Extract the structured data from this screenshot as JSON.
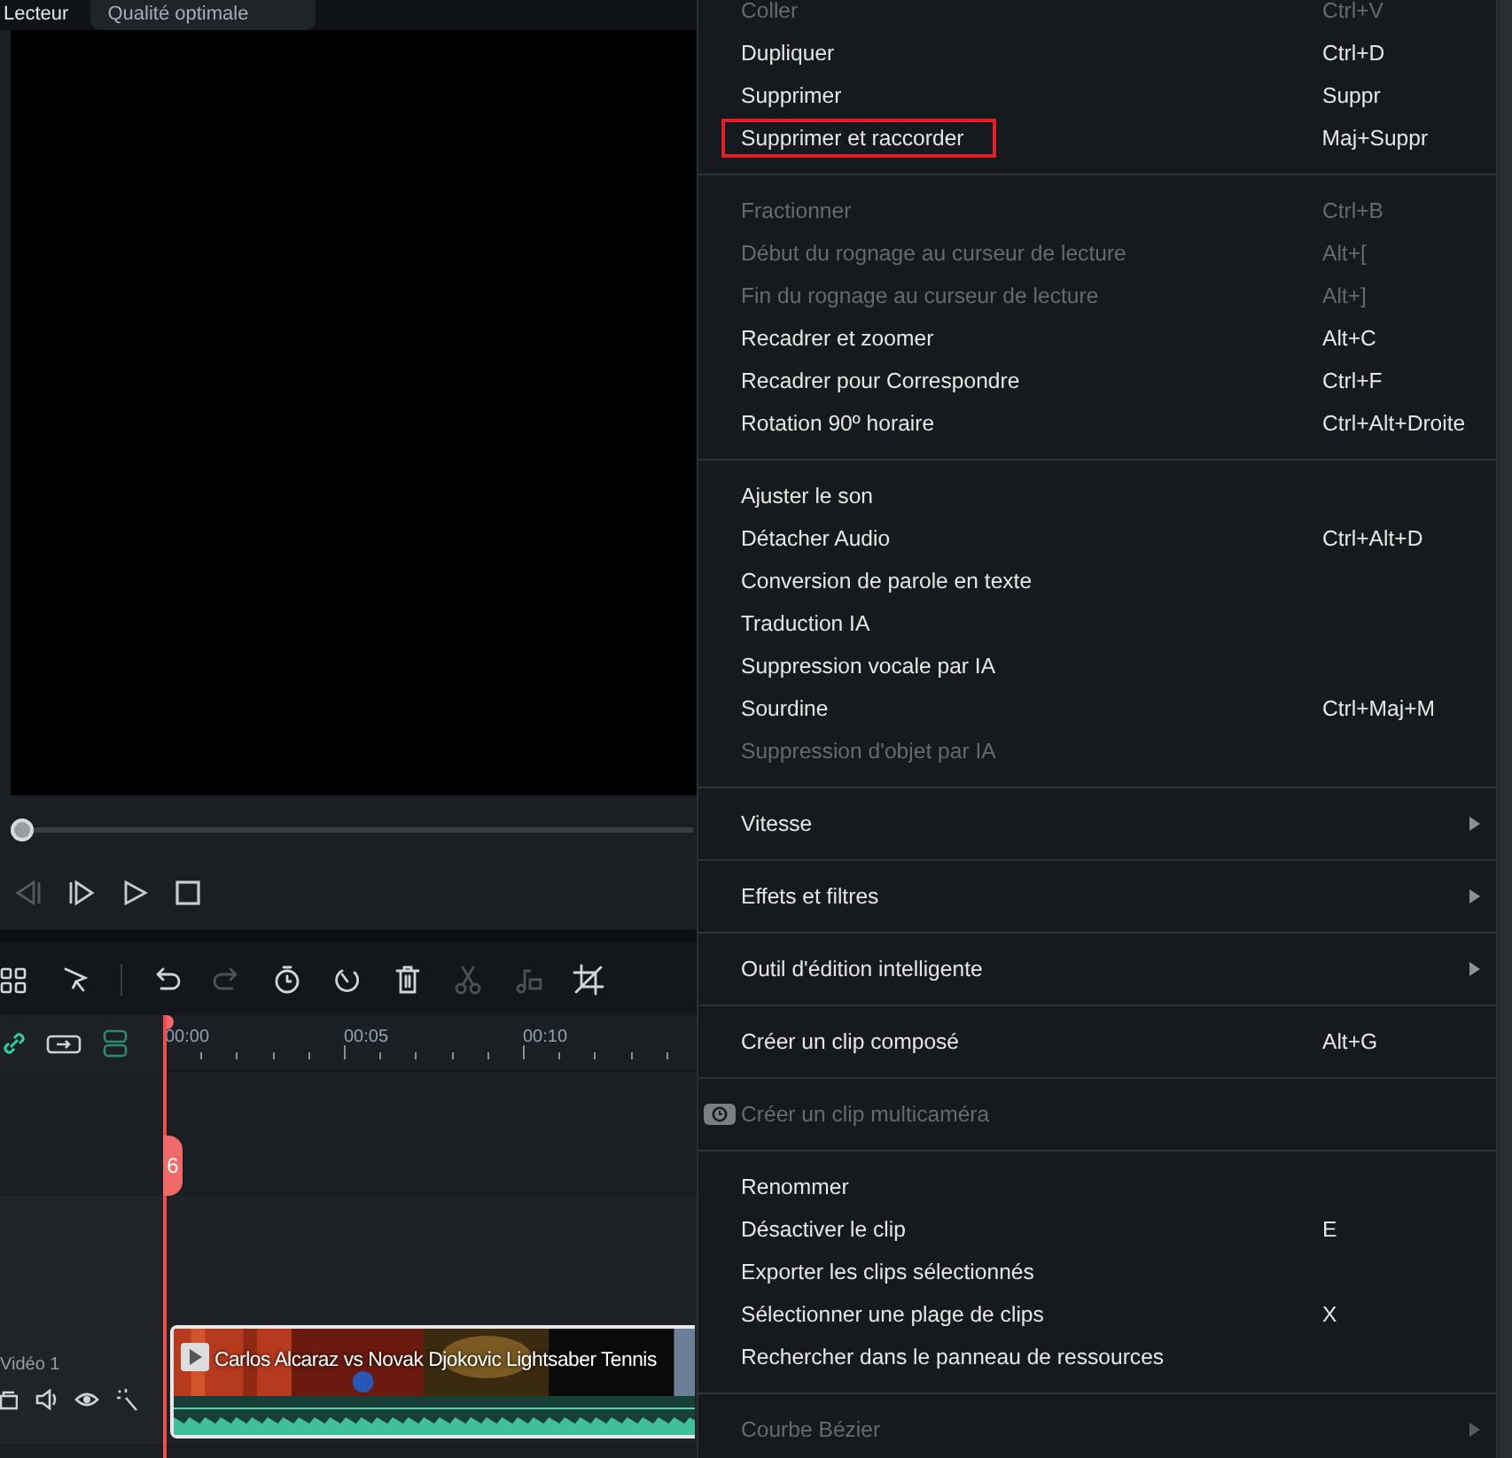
{
  "player": {
    "title": "Lecteur",
    "quality": "Qualité optimale",
    "scrubber": {
      "level": 0
    },
    "controls": [
      {
        "disabled": true
      },
      {
        "disabled": false
      },
      {
        "disabled": false
      },
      {
        "disabled": false
      }
    ]
  },
  "toolbar": [
    {
      "disabled": false
    },
    {
      "disabled": false
    },
    {
      "disabled": false
    },
    {
      "disabled": true
    },
    {
      "disabled": false
    },
    {
      "disabled": false
    },
    {
      "disabled": false
    },
    {
      "disabled": true
    },
    {
      "disabled": true
    },
    {
      "disabled": false
    }
  ],
  "timeline": {
    "ruler": [
      "00:00",
      "00:05",
      "00:10"
    ],
    "playhead_tag": "6",
    "tracks": [
      {
        "kind": "empty"
      },
      {
        "kind": "empty"
      },
      {
        "kind": "video",
        "name": "Vidéo 1",
        "clip": {
          "title": "Carlos Alcaraz vs Novak Djokovic Lightsaber Tennis",
          "selected": true
        }
      }
    ]
  },
  "context_menu": {
    "groups": [
      {
        "items": [
          {
            "label": "Coller",
            "shortcut": "Ctrl+V",
            "disabled": true
          },
          {
            "label": "Dupliquer",
            "shortcut": "Ctrl+D",
            "disabled": false
          },
          {
            "label": "Supprimer",
            "shortcut": "Suppr",
            "disabled": false
          },
          {
            "label": "Supprimer et raccorder",
            "shortcut": "Maj+Suppr",
            "disabled": false,
            "highlighted": true
          }
        ]
      },
      {
        "items": [
          {
            "label": "Fractionner",
            "shortcut": "Ctrl+B",
            "disabled": true
          },
          {
            "label": "Début du rognage au curseur de lecture",
            "shortcut": "Alt+[",
            "disabled": true
          },
          {
            "label": "Fin du rognage au curseur de lecture",
            "shortcut": "Alt+]",
            "disabled": true
          },
          {
            "label": "Recadrer et zoomer",
            "shortcut": "Alt+C",
            "disabled": false
          },
          {
            "label": "Recadrer pour Correspondre",
            "shortcut": "Ctrl+F",
            "disabled": false
          },
          {
            "label": "Rotation 90º horaire",
            "shortcut": "Ctrl+Alt+Droite",
            "disabled": false
          }
        ]
      },
      {
        "items": [
          {
            "label": "Ajuster le son",
            "disabled": false
          },
          {
            "label": "Détacher Audio",
            "shortcut": "Ctrl+Alt+D",
            "disabled": false
          },
          {
            "label": "Conversion de parole en texte",
            "disabled": false
          },
          {
            "label": "Traduction IA",
            "disabled": false
          },
          {
            "label": "Suppression vocale par IA",
            "disabled": false
          },
          {
            "label": "Sourdine",
            "shortcut": "Ctrl+Maj+M",
            "disabled": false
          },
          {
            "label": "Suppression d'objet par IA",
            "disabled": true
          }
        ]
      },
      {
        "items": [
          {
            "label": "Vitesse",
            "disabled": false,
            "submenu": true
          }
        ]
      },
      {
        "items": [
          {
            "label": "Effets et filtres",
            "disabled": false,
            "submenu": true
          }
        ]
      },
      {
        "items": [
          {
            "label": "Outil d'édition intelligente",
            "disabled": false,
            "submenu": true
          }
        ]
      },
      {
        "items": [
          {
            "label": "Créer un clip composé",
            "shortcut": "Alt+G",
            "disabled": false
          }
        ]
      },
      {
        "items": [
          {
            "label": "Créer un clip multicaméra",
            "disabled": true,
            "toggle_icon": true
          }
        ]
      },
      {
        "items": [
          {
            "label": "Renommer",
            "disabled": false
          },
          {
            "label": "Désactiver le clip",
            "shortcut": "E",
            "disabled": false
          },
          {
            "label": "Exporter les clips sélectionnés",
            "disabled": false
          },
          {
            "label": "Sélectionner une plage de clips",
            "shortcut": "X",
            "disabled": false
          },
          {
            "label": "Rechercher dans le panneau de ressources",
            "disabled": false
          }
        ]
      },
      {
        "items": [
          {
            "label": "Courbe Bézier",
            "disabled": true,
            "submenu": true
          }
        ]
      }
    ]
  }
}
